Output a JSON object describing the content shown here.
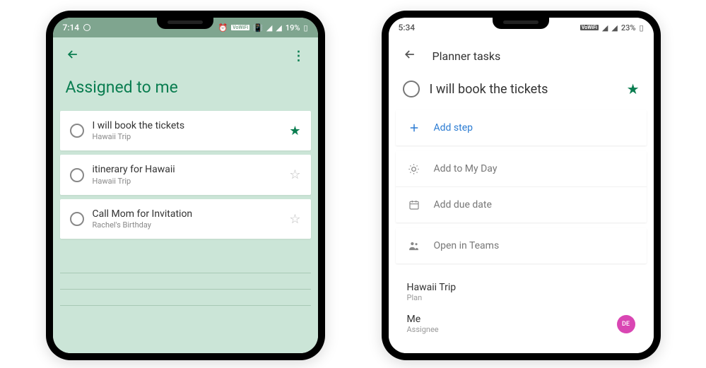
{
  "phone1": {
    "status": {
      "time": "7:14",
      "battery": "19%"
    },
    "header": {
      "title": "Assigned to me"
    },
    "tasks": [
      {
        "title": "I will book the tickets",
        "subtitle": "Hawaii Trip",
        "starred": true
      },
      {
        "title": "itinerary for Hawaii",
        "subtitle": "Hawaii Trip",
        "starred": false
      },
      {
        "title": "Call Mom for Invitation",
        "subtitle": "Rachel's Birthday",
        "starred": false
      }
    ]
  },
  "phone2": {
    "status": {
      "time": "5:34",
      "battery": "23%"
    },
    "header": {
      "title": "Planner tasks"
    },
    "task": {
      "title": "I will book the tickets",
      "starred": true
    },
    "actions": {
      "add_step": "Add step",
      "my_day": "Add to My Day",
      "due_date": "Add due date",
      "teams": "Open in Teams"
    },
    "plan": {
      "title": "Hawaii Trip",
      "label": "Plan"
    },
    "assignee": {
      "title": "Me",
      "label": "Assignee",
      "initials": "DE"
    }
  }
}
